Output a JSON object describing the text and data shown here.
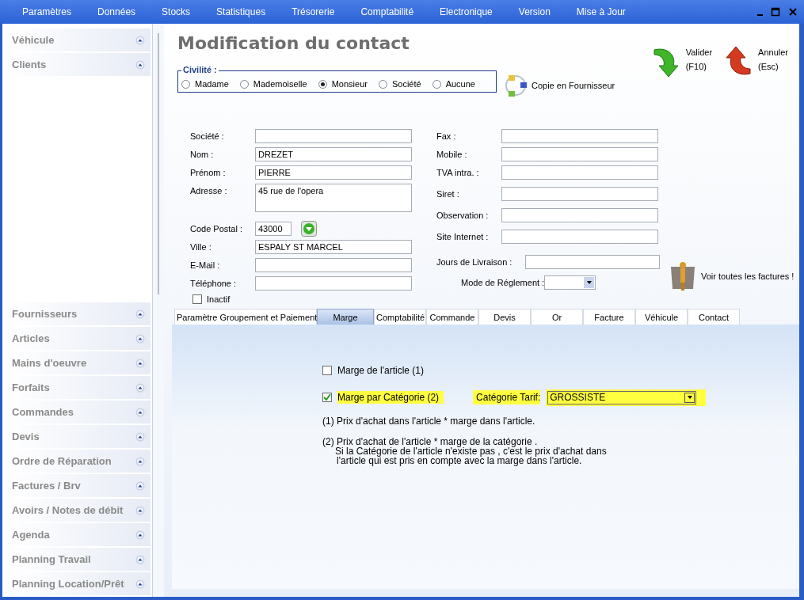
{
  "menu": [
    "Paramètres",
    "Données",
    "Stocks",
    "Statistiques",
    "Trésorerie",
    "Comptabilité",
    "Electronique",
    "Version",
    "Mise à Jour"
  ],
  "sidebar": {
    "top_items": [
      {
        "label": "Véhicule"
      },
      {
        "label": "Clients"
      }
    ],
    "bottom_items": [
      {
        "label": "Fournisseurs"
      },
      {
        "label": "Articles"
      },
      {
        "label": "Mains d'oeuvre"
      },
      {
        "label": "Forfaits"
      },
      {
        "label": "Commandes"
      },
      {
        "label": "Devis"
      },
      {
        "label": "Ordre de Réparation"
      },
      {
        "label": "Factures / Brv"
      },
      {
        "label": "Avoirs / Notes de débit"
      },
      {
        "label": "Agenda"
      },
      {
        "label": "Planning Travail"
      },
      {
        "label": "Planning Location/Prêt"
      }
    ]
  },
  "title": "Modification du contact",
  "civilite": {
    "legend": "Civilité :",
    "options": [
      {
        "label": "Madame",
        "selected": false
      },
      {
        "label": "Mademoiselle",
        "selected": false
      },
      {
        "label": "Monsieur",
        "selected": true
      },
      {
        "label": "Société",
        "selected": false
      },
      {
        "label": "Aucune",
        "selected": false
      }
    ]
  },
  "copy_button": "Copie en Fournisseur",
  "actions": [
    {
      "kind": "valider",
      "label": "Valider",
      "shortcut": "(F10)"
    },
    {
      "kind": "annuler",
      "label": "Annuler",
      "shortcut": "(Esc)"
    }
  ],
  "left_fields": [
    {
      "label": "Société :",
      "kind": "text"
    },
    {
      "label": "Nom :",
      "kind": "text",
      "value": "DREZET"
    },
    {
      "label": "Prénom :",
      "kind": "text",
      "value": "PIERRE"
    },
    {
      "label": "Adresse :",
      "kind": "area",
      "value": "45 rue de l'opera"
    },
    {
      "label": "Code Postal :",
      "kind": "postal",
      "value": "43000"
    },
    {
      "label": "Ville :",
      "kind": "text",
      "value": "ESPALY ST MARCEL"
    },
    {
      "label": "E-Mail :",
      "kind": "text"
    },
    {
      "label": "Téléphone :",
      "kind": "text"
    }
  ],
  "right_fields": [
    {
      "label": "Fax :",
      "kind": "text"
    },
    {
      "label": "Mobile :",
      "kind": "text"
    },
    {
      "label": "TVA intra. :",
      "kind": "text"
    },
    {
      "label": "Siret :",
      "kind": "text"
    },
    {
      "label": "Observation :",
      "kind": "text"
    },
    {
      "label": "Site Internet :",
      "kind": "text"
    },
    {
      "label": "Jours de Livraison :",
      "kind": "short"
    },
    {
      "label": "Mode de Réglement :",
      "kind": "select"
    }
  ],
  "invoices_button": "Voir toutes les factures !",
  "inactif": {
    "label": "Inactif",
    "checked": false
  },
  "tabs": [
    {
      "label": "Paramètre Groupement et Paiement",
      "selected": false
    },
    {
      "label": "Marge",
      "selected": true
    },
    {
      "label": "Comptabilité",
      "selected": false
    },
    {
      "label": "Commande",
      "selected": false
    },
    {
      "label": "Devis",
      "selected": false
    },
    {
      "label": "Or",
      "selected": false
    },
    {
      "label": "Facture",
      "selected": false
    },
    {
      "label": "Véhicule",
      "selected": false
    },
    {
      "label": "Contact",
      "selected": false
    }
  ],
  "marge": {
    "options": [
      {
        "label": "Marge de l'article  (1)",
        "checked": false,
        "highlighted": false
      },
      {
        "label": "Marge par Catégorie  (2)",
        "checked": true,
        "highlighted": true
      }
    ],
    "category_label": "Catégorie Tarif:",
    "category_value": "GROSSISTE",
    "notes": [
      "(1) Prix d'achat dans l'article * marge dans l'article.",
      "(2) Prix d'achat de l'article * marge de la catégorie .",
      "Si la Catégorie de l'article n'existe pas , c'est le prix d'achat dans",
      "l'article qui est pris en compte avec la marge dans l'article."
    ]
  }
}
